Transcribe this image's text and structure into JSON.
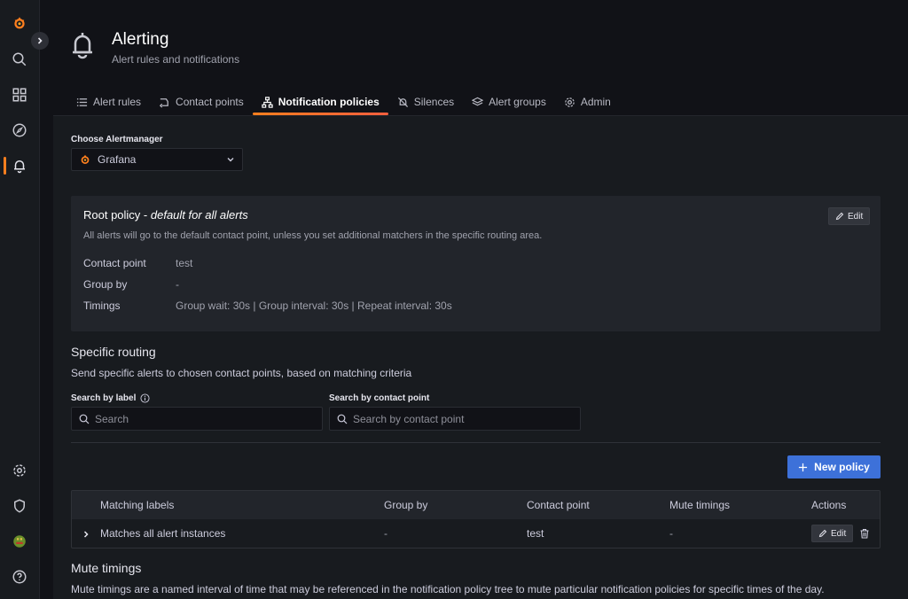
{
  "app": {
    "brand_color": "#ff7f1e",
    "accent": "#3d71d9"
  },
  "sidebar": {
    "items": [
      {
        "name": "grafana-logo",
        "icon": "grafana-logo-icon"
      },
      {
        "name": "search",
        "icon": "search-icon"
      },
      {
        "name": "dashboards",
        "icon": "apps-grid-icon"
      },
      {
        "name": "explore",
        "icon": "compass-icon"
      },
      {
        "name": "alerting",
        "icon": "bell-icon",
        "active": true
      },
      {
        "name": "configuration",
        "icon": "gear-icon"
      },
      {
        "name": "server-admin",
        "icon": "shield-icon"
      },
      {
        "name": "profile",
        "icon": "avatar-icon"
      },
      {
        "name": "help",
        "icon": "help-icon"
      }
    ]
  },
  "header": {
    "title": "Alerting",
    "subtitle": "Alert rules and notifications"
  },
  "tabs": [
    {
      "label": "Alert rules",
      "icon": "list-icon"
    },
    {
      "label": "Contact points",
      "icon": "contact-icon"
    },
    {
      "label": "Notification policies",
      "icon": "sitemap-icon",
      "active": true
    },
    {
      "label": "Silences",
      "icon": "bell-slash-icon"
    },
    {
      "label": "Alert groups",
      "icon": "layer-group-icon"
    },
    {
      "label": "Admin",
      "icon": "cog-icon"
    }
  ],
  "alertmanager": {
    "label": "Choose Alertmanager",
    "selected": "Grafana"
  },
  "root_policy": {
    "title": "Root policy",
    "title_suffix": "default for all alerts",
    "separator": " - ",
    "description": "All alerts will go to the default contact point, unless you set additional matchers in the specific routing area.",
    "edit_label": "Edit",
    "rows": [
      {
        "key": "Contact point",
        "value": "test"
      },
      {
        "key": "Group by",
        "value": "-"
      },
      {
        "key": "Timings",
        "value": "Group wait: 30s | Group interval: 30s | Repeat interval: 30s"
      }
    ]
  },
  "specific_routing": {
    "title": "Specific routing",
    "description": "Send specific alerts to chosen contact points, based on matching criteria",
    "search_label_title": "Search by label",
    "search_label_placeholder": "Search",
    "search_contact_title": "Search by contact point",
    "search_contact_placeholder": "Search by contact point",
    "new_policy_label": "New policy"
  },
  "table": {
    "headers": {
      "matching_labels": "Matching labels",
      "group_by": "Group by",
      "contact_point": "Contact point",
      "mute_timings": "Mute timings",
      "actions": "Actions"
    },
    "rows": [
      {
        "matching_labels": "Matches all alert instances",
        "group_by": "-",
        "contact_point": "test",
        "mute_timings": "-",
        "edit_label": "Edit"
      }
    ]
  },
  "mute_timings": {
    "title": "Mute timings",
    "description": "Mute timings are a named interval of time that may be referenced in the notification policy tree to mute particular notification policies for specific times of the day."
  }
}
